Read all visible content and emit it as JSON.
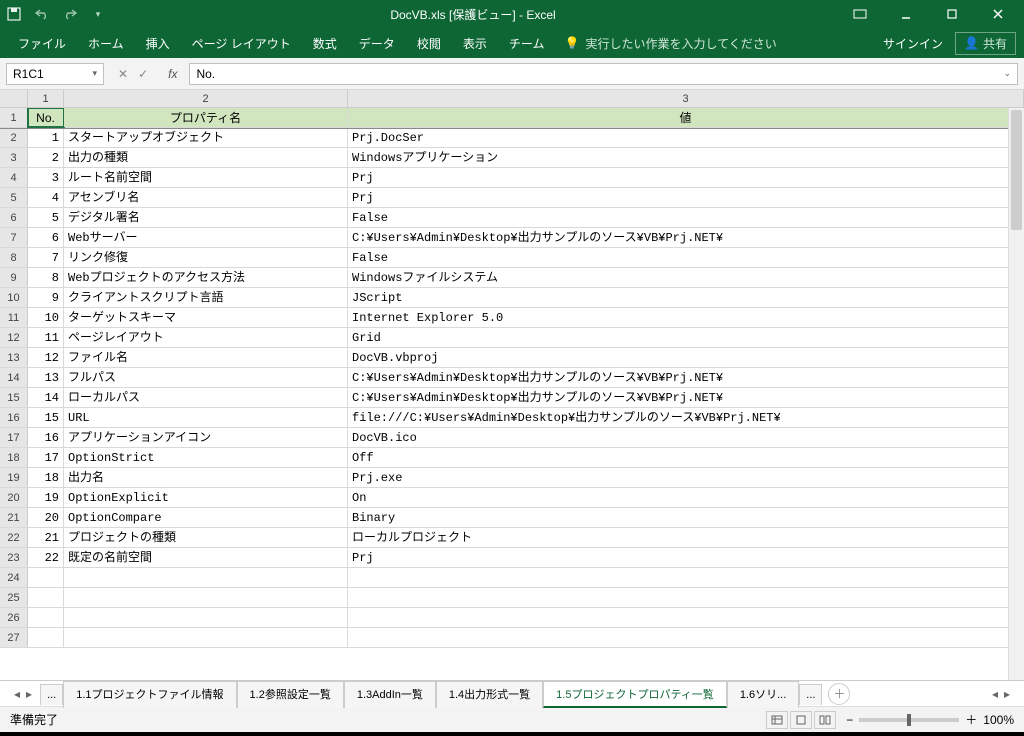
{
  "title": "DocVB.xls  [保護ビュー] - Excel",
  "qat": {
    "save": "保存",
    "undo": "元に戻す",
    "redo": "やり直し"
  },
  "ribbon": {
    "tabs": [
      "ファイル",
      "ホーム",
      "挿入",
      "ページ レイアウト",
      "数式",
      "データ",
      "校閲",
      "表示",
      "チーム"
    ],
    "tellme": "実行したい作業を入力してください",
    "signin": "サインイン",
    "share": "共有"
  },
  "namebox": "R1C1",
  "formula": "No.",
  "headers": {
    "c1": "No.",
    "c2": "プロパティ名",
    "c3": "値"
  },
  "rows": [
    {
      "n": "1",
      "p": "スタートアップオブジェクト",
      "v": "Prj.DocSer"
    },
    {
      "n": "2",
      "p": "出力の種類",
      "v": "Windowsアプリケーション"
    },
    {
      "n": "3",
      "p": "ルート名前空間",
      "v": "Prj"
    },
    {
      "n": "4",
      "p": "アセンブリ名",
      "v": "Prj"
    },
    {
      "n": "5",
      "p": "デジタル署名",
      "v": "False"
    },
    {
      "n": "6",
      "p": "Webサーバー",
      "v": "C:¥Users¥Admin¥Desktop¥出力サンプルのソース¥VB¥Prj.NET¥"
    },
    {
      "n": "7",
      "p": "リンク修復",
      "v": "False"
    },
    {
      "n": "8",
      "p": "Webプロジェクトのアクセス方法",
      "v": "Windowsファイルシステム"
    },
    {
      "n": "9",
      "p": "クライアントスクリプト言語",
      "v": "JScript"
    },
    {
      "n": "10",
      "p": "ターゲットスキーマ",
      "v": "Internet Explorer 5.0"
    },
    {
      "n": "11",
      "p": "ページレイアウト",
      "v": "Grid"
    },
    {
      "n": "12",
      "p": "ファイル名",
      "v": "DocVB.vbproj"
    },
    {
      "n": "13",
      "p": "フルパス",
      "v": "C:¥Users¥Admin¥Desktop¥出力サンプルのソース¥VB¥Prj.NET¥"
    },
    {
      "n": "14",
      "p": "ローカルパス",
      "v": "C:¥Users¥Admin¥Desktop¥出力サンプルのソース¥VB¥Prj.NET¥"
    },
    {
      "n": "15",
      "p": "URL",
      "v": "file:///C:¥Users¥Admin¥Desktop¥出力サンプルのソース¥VB¥Prj.NET¥"
    },
    {
      "n": "16",
      "p": "アプリケーションアイコン",
      "v": "DocVB.ico"
    },
    {
      "n": "17",
      "p": "OptionStrict",
      "v": "Off"
    },
    {
      "n": "18",
      "p": "出力名",
      "v": "Prj.exe"
    },
    {
      "n": "19",
      "p": "OptionExplicit",
      "v": "On"
    },
    {
      "n": "20",
      "p": "OptionCompare",
      "v": "Binary"
    },
    {
      "n": "21",
      "p": "プロジェクトの種類",
      "v": "ローカルプロジェクト"
    },
    {
      "n": "22",
      "p": "既定の名前空間",
      "v": "Prj"
    }
  ],
  "emptyRows": [
    "24",
    "25",
    "26",
    "27"
  ],
  "sheets": {
    "more": "...",
    "tabs": [
      "1.1プロジェクトファイル情報",
      "1.2参照設定一覧",
      "1.3AddIn一覧",
      "1.4出力形式一覧",
      "1.5プロジェクトプロパティ一覧",
      "1.6ソリ..."
    ],
    "active": 4
  },
  "status": {
    "ready": "準備完了",
    "zoom": "100%"
  }
}
